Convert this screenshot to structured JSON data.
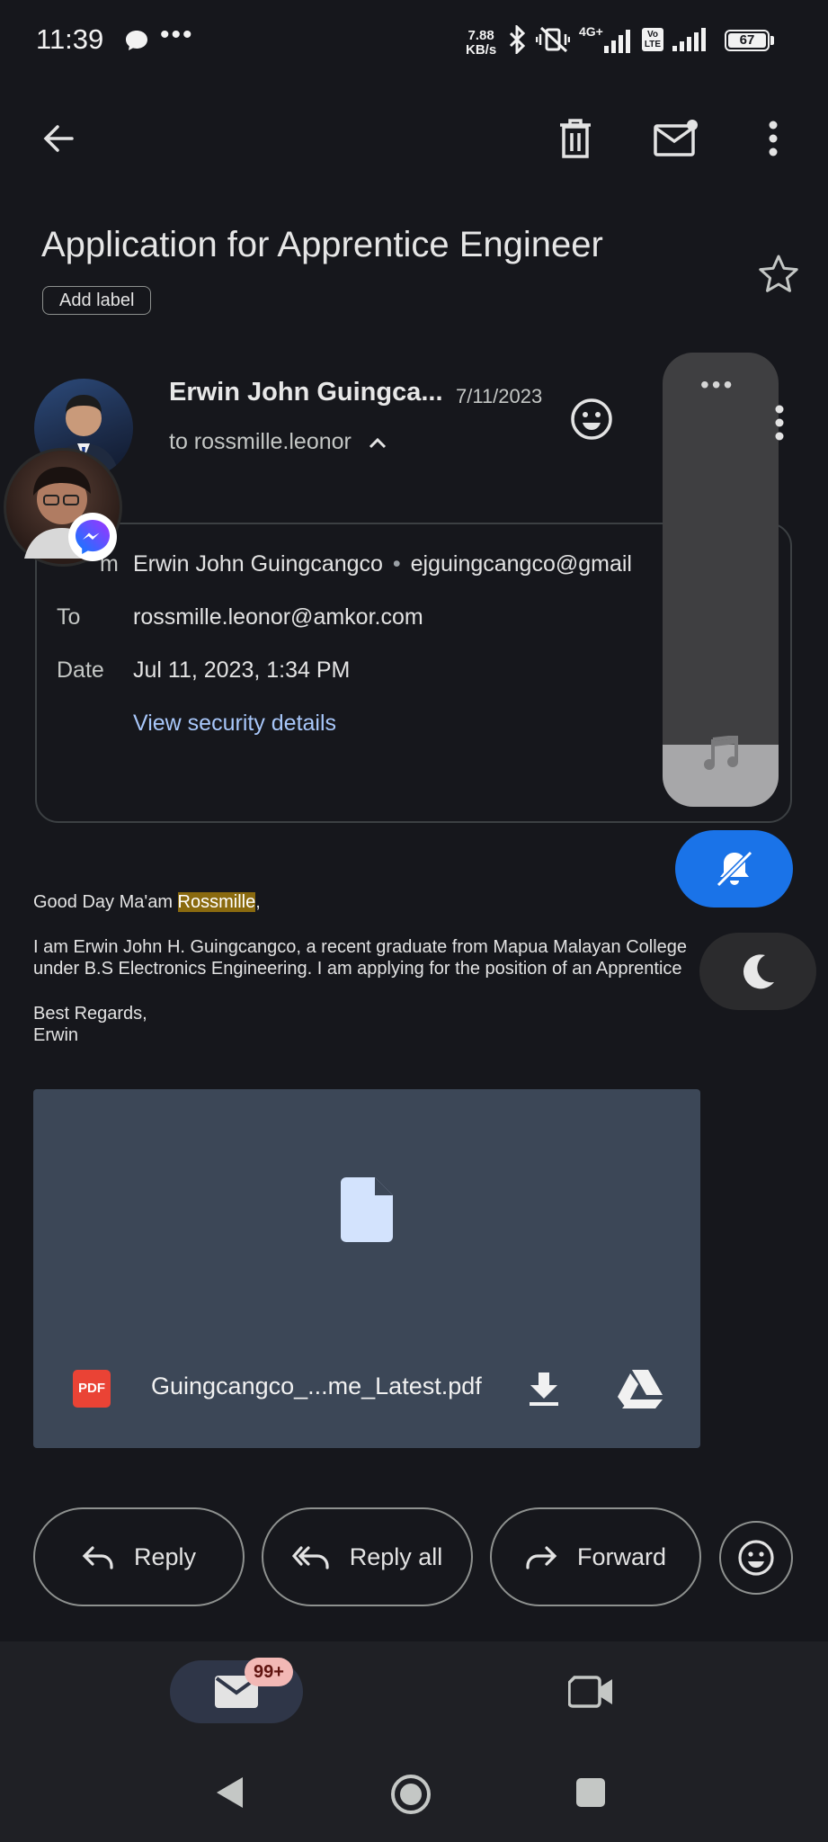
{
  "status_bar": {
    "time": "11:39",
    "more": "•••",
    "net_speed_value": "7.88",
    "net_speed_unit": "KB/s",
    "signal_label": "4G+",
    "volte_label": "Vo LTE",
    "battery": "67"
  },
  "email": {
    "subject": "Application for Apprentice Engineer",
    "add_label": "Add label",
    "sender_name": "Erwin John Guingca...",
    "date_short": "7/11/2023",
    "to_line": "to rossmille.leonor"
  },
  "details": {
    "from_label": "m",
    "from_name": "Erwin John Guingcangco",
    "from_sep": "•",
    "from_email": "ejguingcangco@gmail",
    "to_label": "To",
    "to_value": "rossmille.leonor@amkor.com",
    "date_label": "Date",
    "date_value": "Jul 11, 2023, 1:34 PM",
    "security_link": "View security details"
  },
  "body": {
    "greeting_pre": "Good Day Ma'am ",
    "greeting_name": "Rossmille",
    "greeting_post": ",",
    "para_line1": "I am Erwin John H. Guingcangco, a recent graduate from Mapua Malayan College",
    "para_line2": "under B.S Electronics Engineering. I am applying for the position of an Apprentice",
    "closing": "Best Regards,",
    "signature": "Erwin"
  },
  "attachment": {
    "type_badge": "PDF",
    "filename": "Guingcangco_...me_Latest.pdf"
  },
  "actions": {
    "reply": "Reply",
    "reply_all": "Reply all",
    "forward": "Forward"
  },
  "bottom_nav": {
    "mail_badge": "99+"
  },
  "colors": {
    "background": "#16171c",
    "link": "#a8c7fa",
    "attachment_bg": "#3c4757",
    "accent_blue": "#1a73e8",
    "highlight": "#8a6a0f"
  }
}
